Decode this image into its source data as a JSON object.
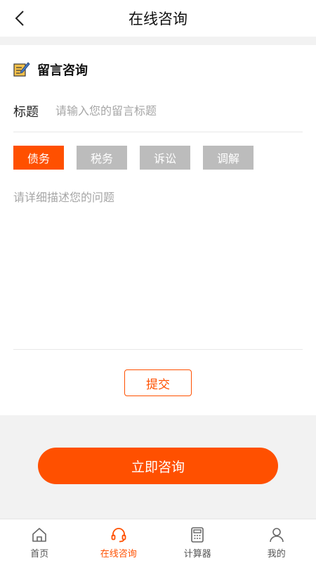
{
  "header": {
    "title": "在线咨询",
    "back_icon": "chevron-left-icon"
  },
  "form": {
    "section_title": "留言咨询",
    "section_icon": "note-pen-icon",
    "title_label": "标题",
    "title_placeholder": "请输入您的留言标题",
    "title_value": "",
    "categories": [
      {
        "label": "债务",
        "selected": true
      },
      {
        "label": "税务",
        "selected": false
      },
      {
        "label": "诉讼",
        "selected": false
      },
      {
        "label": "调解",
        "selected": false
      }
    ],
    "description_placeholder": "请详细描述您的问题",
    "description_value": "",
    "submit_label": "提交"
  },
  "cta": {
    "label": "立即咨询"
  },
  "tabbar": {
    "items": [
      {
        "label": "首页",
        "icon": "home-icon",
        "active": false
      },
      {
        "label": "在线咨询",
        "icon": "headset-icon",
        "active": true
      },
      {
        "label": "计算器",
        "icon": "calculator-icon",
        "active": false
      },
      {
        "label": "我的",
        "icon": "user-icon",
        "active": false
      }
    ]
  },
  "colors": {
    "accent": "#ff5000",
    "tag_inactive": "#bcbcbc",
    "background": "#f2f2f2"
  }
}
